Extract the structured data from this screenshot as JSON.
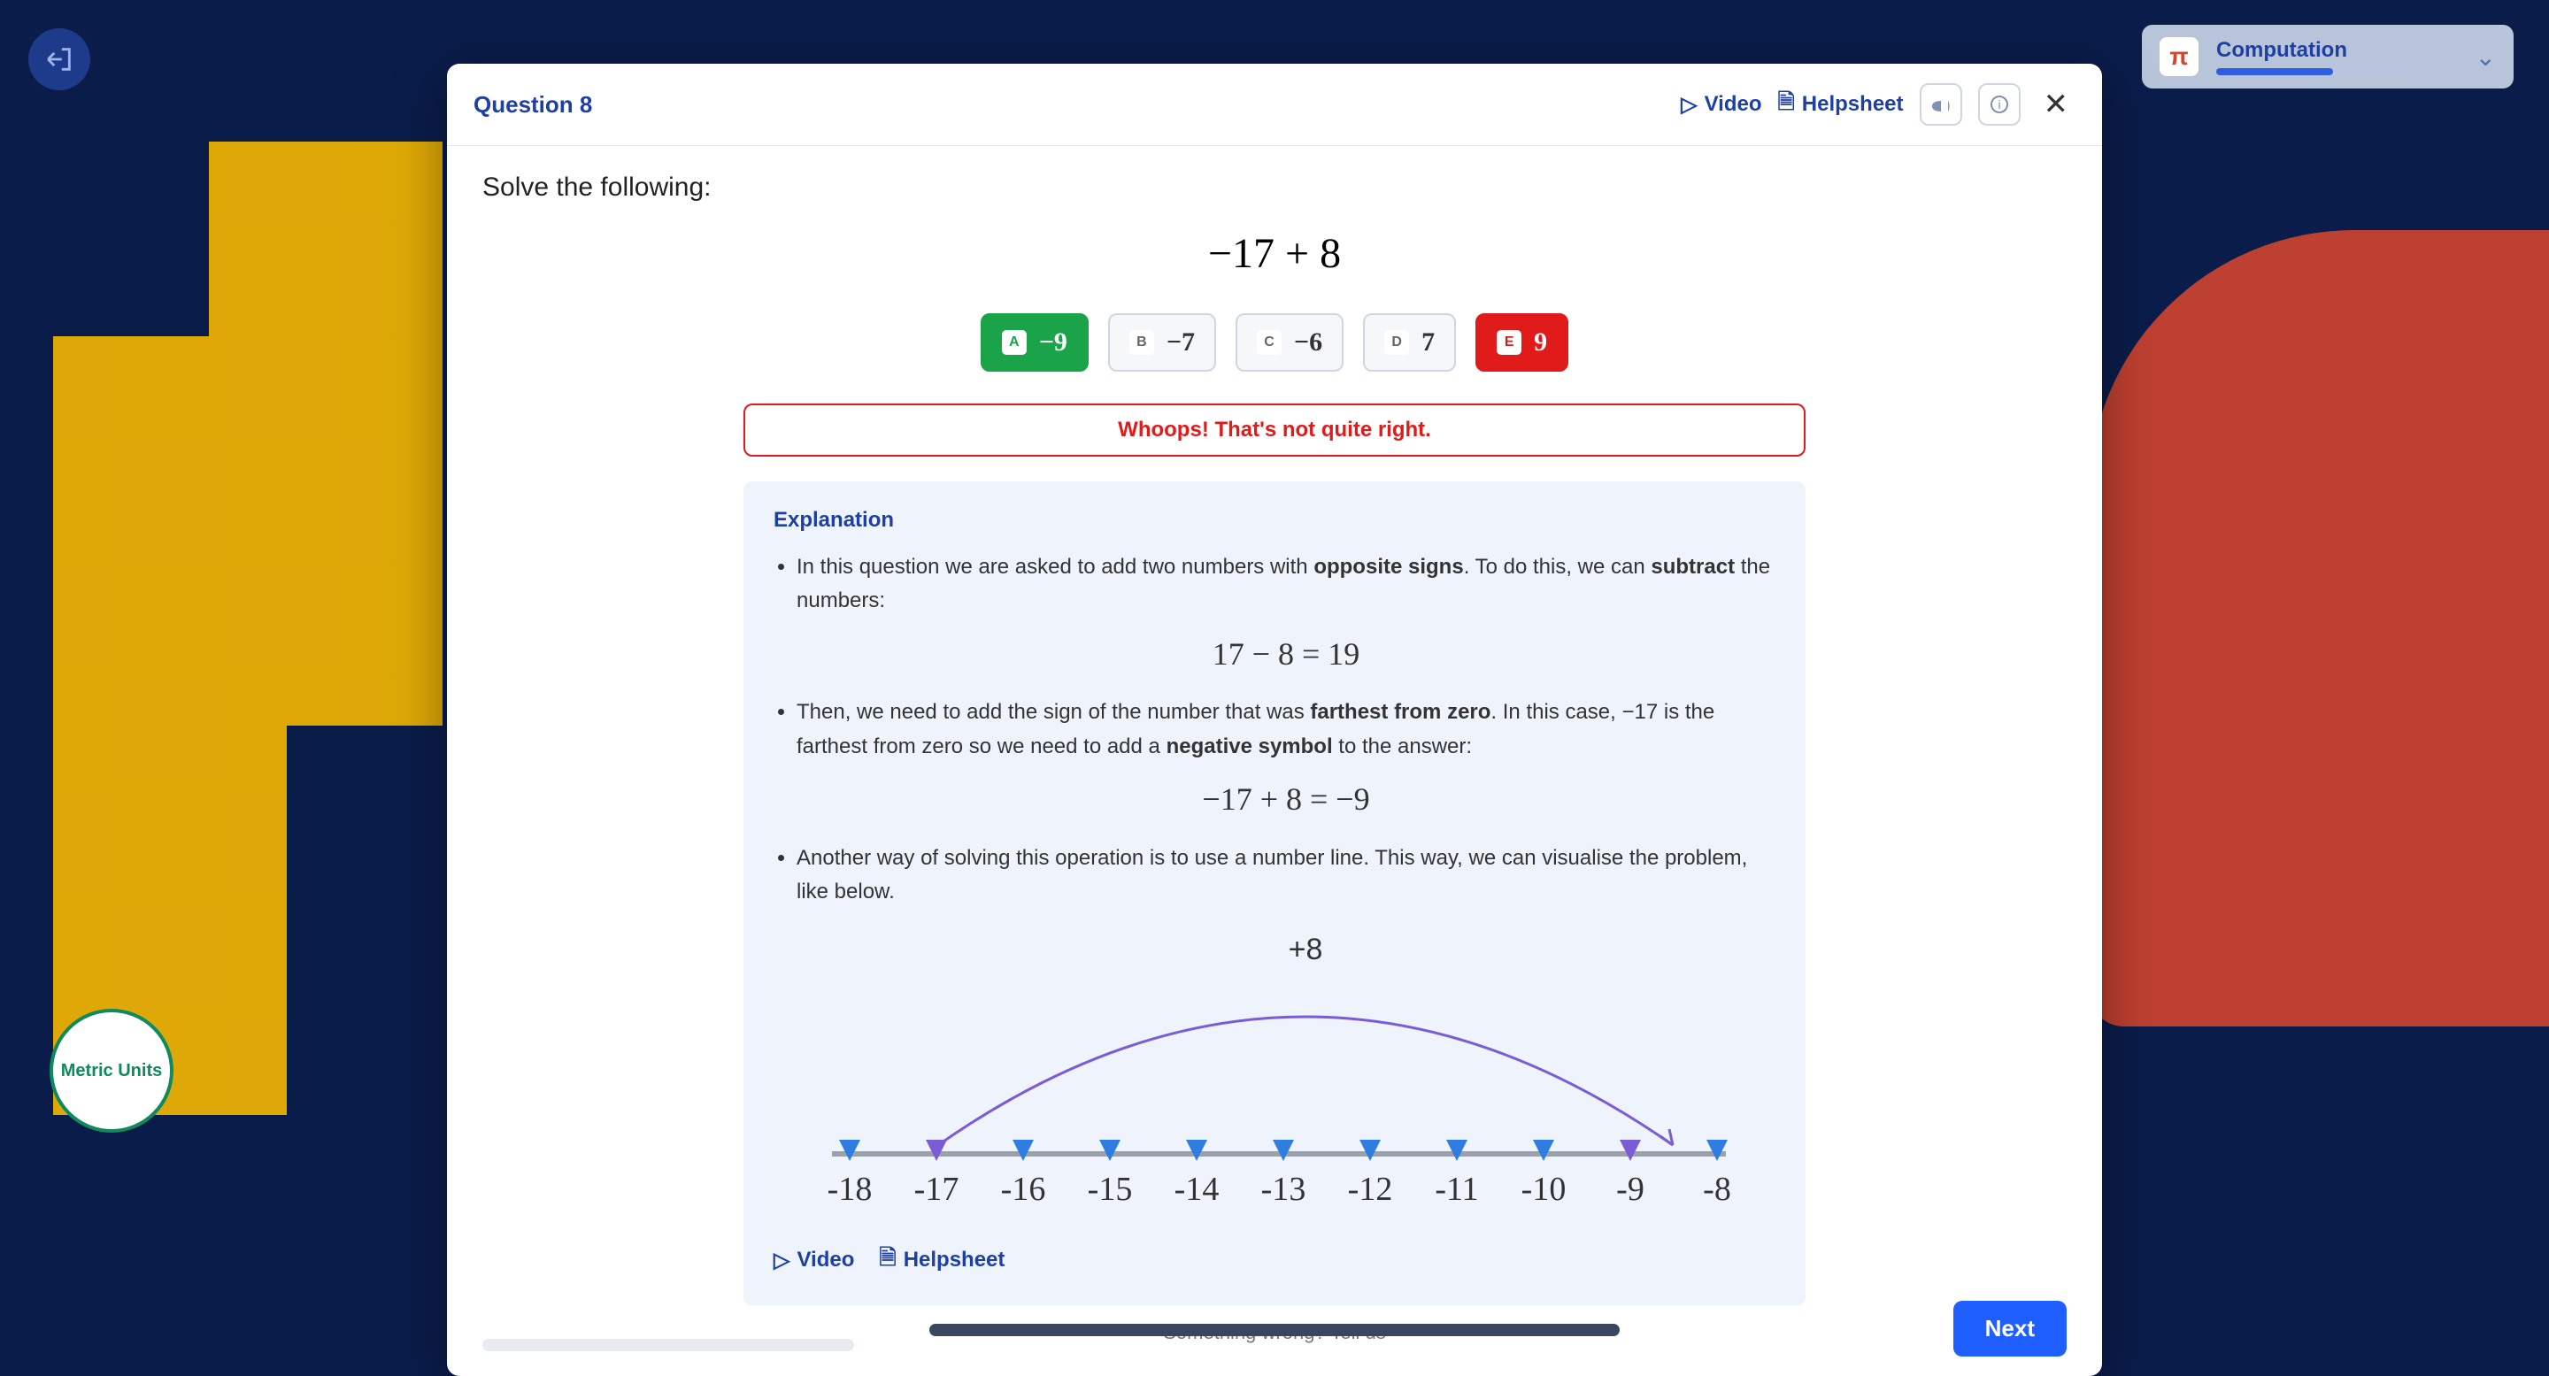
{
  "header": {
    "question_label": "Question 8",
    "video": "Video",
    "helpsheet": "Helpsheet"
  },
  "sidebar": {
    "computation": "Computation",
    "metric": "Metric Units",
    "pi": "π"
  },
  "problem": {
    "prompt": "Solve the following:",
    "expression": "−17 + 8"
  },
  "choices": [
    {
      "letter": "A",
      "value": "−9",
      "state": "correct"
    },
    {
      "letter": "B",
      "value": "−7",
      "state": "default"
    },
    {
      "letter": "C",
      "value": "−6",
      "state": "default"
    },
    {
      "letter": "D",
      "value": "7",
      "state": "default"
    },
    {
      "letter": "E",
      "value": "9",
      "state": "wrong"
    }
  ],
  "feedback": "Whoops! That's not quite right.",
  "explanation": {
    "title": "Explanation",
    "p1a": "In this question we are asked to add two numbers with ",
    "p1b": "opposite signs",
    "p1c": ". To do this, we can ",
    "p1d": "subtract",
    "p1e": " the numbers:",
    "math1": "17 − 8 = 19",
    "p2a": "Then, we need to add the sign of the number that was ",
    "p2b": "farthest from zero",
    "p2c": ". In this case, −17 is the farthest from zero so we need to add a ",
    "p2d": "negative symbol",
    "p2e": " to the answer:",
    "math2": "−17 + 8 = −9",
    "p3": "Another way of solving this operation is to use a number line. This way, we can visualise the problem, like below.",
    "arc_label": "+8",
    "ticks": [
      "-18",
      "-17",
      "-16",
      "-15",
      "-14",
      "-13",
      "-12",
      "-11",
      "-10",
      "-9",
      "-8"
    ],
    "video": "Video",
    "helpsheet": "Helpsheet"
  },
  "footer": {
    "report": "Something wrong? Tell us",
    "next": "Next"
  }
}
